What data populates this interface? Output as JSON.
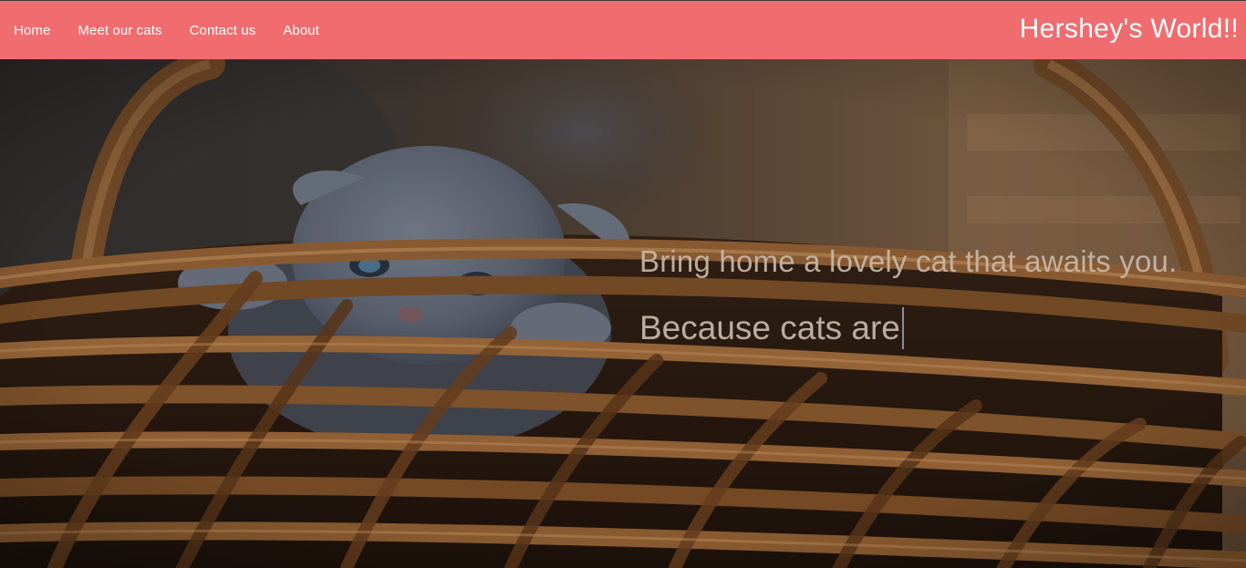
{
  "navbar": {
    "links": [
      "Home",
      "Meet our cats",
      "Contact us",
      "About"
    ],
    "brand": "Hershey's World!!",
    "background_color": "#f06c6f"
  },
  "hero": {
    "image_subject": "grey kitten in wicker basket",
    "tagline": "Bring home a lovely cat that awaits you.",
    "typed_text": "Because cats are"
  }
}
